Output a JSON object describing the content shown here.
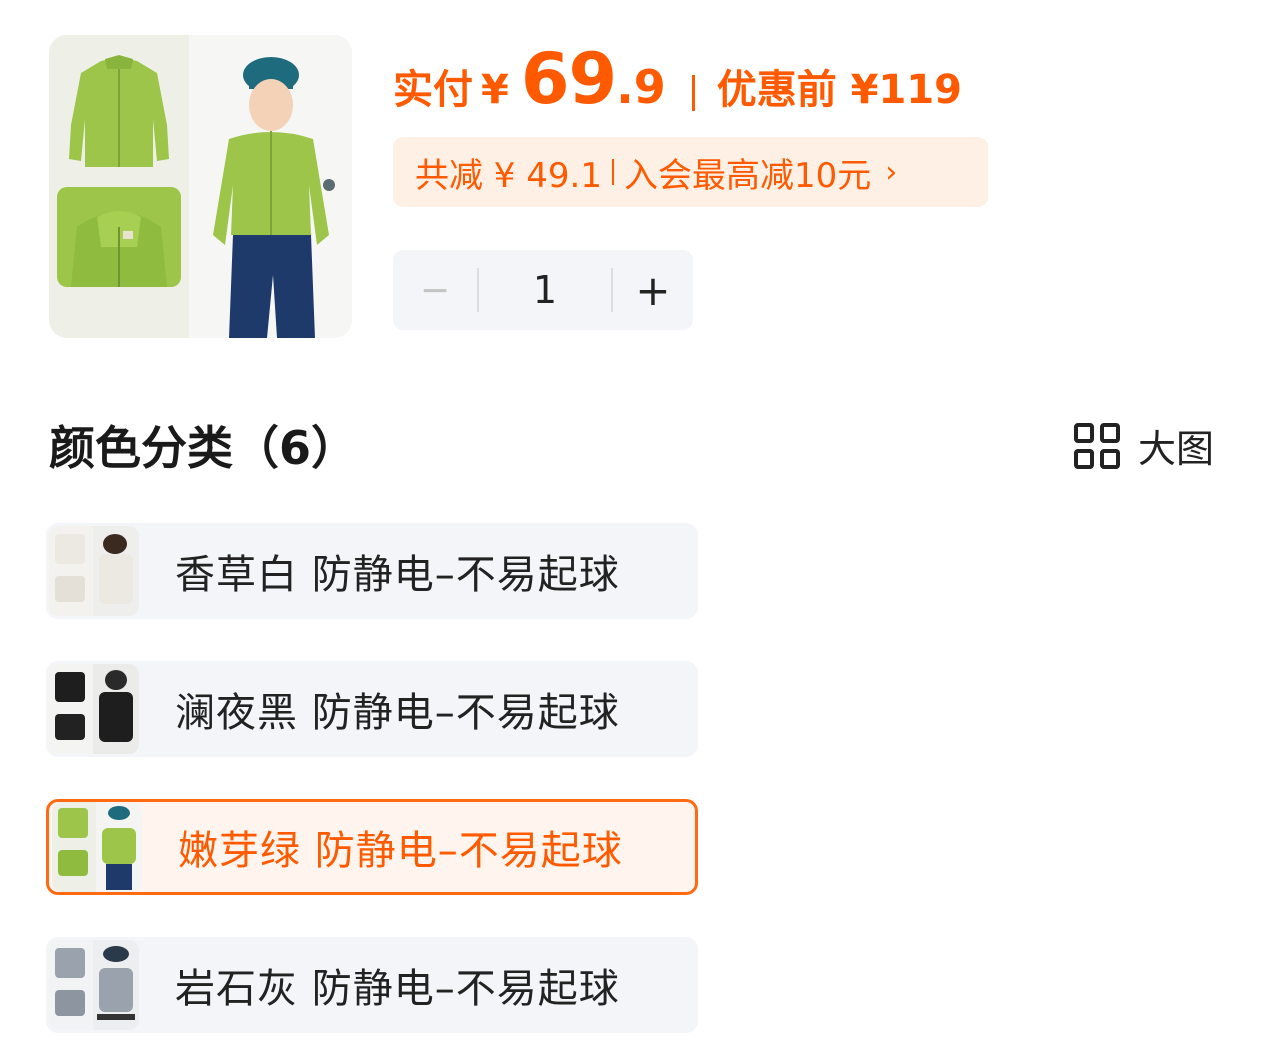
{
  "price": {
    "label": "实付",
    "currency": "¥",
    "integer": "69",
    "decimal": ".9",
    "original": "优惠前 ¥119"
  },
  "discount": {
    "total": "共减 ¥ 49.1",
    "member": "入会最高减10元",
    "chevron_icon": "chevron-right-icon"
  },
  "stepper": {
    "minus": "−",
    "value": "1",
    "plus": "+"
  },
  "section": {
    "title": "颜色分类（6）",
    "big_view_label": "大图",
    "big_view_icon": "grid-view-icon"
  },
  "options": [
    {
      "label": "香草白 防静电–不易起球",
      "selected": false,
      "color": "#ece9e3"
    },
    {
      "label": "澜夜黑 防静电–不易起球",
      "selected": false,
      "color": "#1e1e1e"
    },
    {
      "label": "嫩芽绿 防静电–不易起球",
      "selected": true,
      "color": "#9cc54a"
    },
    {
      "label": "岩石灰 防静电–不易起球",
      "selected": false,
      "color": "#9aa3ad"
    }
  ],
  "colors": {
    "accent": "#ff5a00",
    "accent_bg": "#fff0e6",
    "option_bg": "#f3f5f8"
  }
}
